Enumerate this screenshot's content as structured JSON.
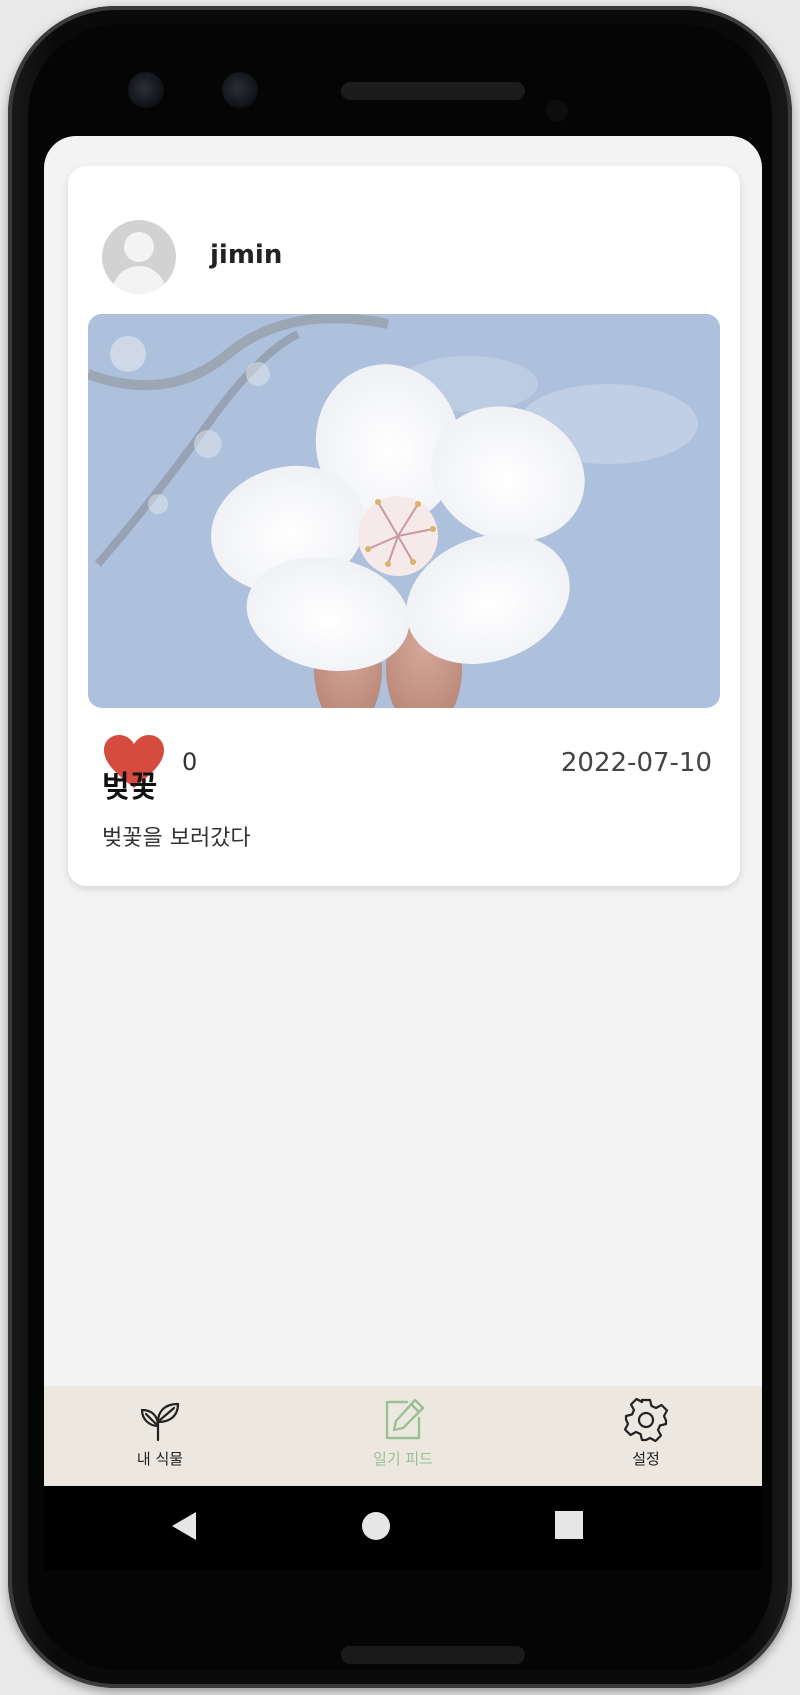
{
  "post": {
    "username": "jimin",
    "like_count": "0",
    "date": "2022-07-10",
    "title": "벚꽃",
    "body": "벚꽃을 보러갔다",
    "liked": true
  },
  "tabbar": {
    "items": [
      {
        "label": "내 식물",
        "icon": "sprout-icon",
        "active": false
      },
      {
        "label": "일기 피드",
        "icon": "edit-icon",
        "active": true
      },
      {
        "label": "설정",
        "icon": "gear-icon",
        "active": false
      }
    ]
  },
  "navbar": {
    "buttons": [
      "back-icon",
      "home-icon",
      "recents-icon"
    ]
  },
  "colors": {
    "heart": "#d64b3f",
    "tabbar_bg": "#ece8df",
    "active_tab": "#9bbf96",
    "screen_bg": "#f3f3f3"
  }
}
